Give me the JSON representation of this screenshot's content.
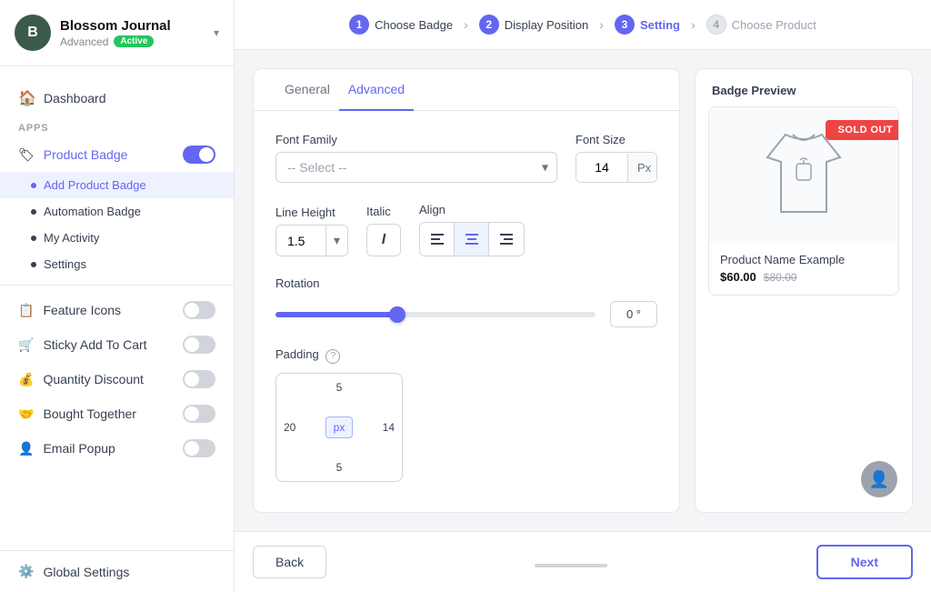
{
  "sidebar": {
    "avatar_letter": "B",
    "shop_name": "Blossom Journal",
    "shop_plan": "Advanced",
    "shop_status": "Active",
    "nav": {
      "dashboard_label": "Dashboard",
      "apps_section": "APPS",
      "apps": [
        {
          "label": "Product Badge",
          "icon": "🏷",
          "toggle": true,
          "active": true,
          "subnav": [
            {
              "label": "Add Product Badge",
              "active": true
            },
            {
              "label": "Automation Badge",
              "active": false
            },
            {
              "label": "My Activity",
              "active": false
            },
            {
              "label": "Settings",
              "active": false
            }
          ]
        },
        {
          "label": "Feature Icons",
          "icon": "📋",
          "toggle": false
        },
        {
          "label": "Sticky Add To Cart",
          "icon": "🛒",
          "toggle": false
        },
        {
          "label": "Quantity Discount",
          "icon": "💰",
          "toggle": false
        },
        {
          "label": "Bought Together",
          "icon": "🤝",
          "toggle": false
        },
        {
          "label": "Email Popup",
          "icon": "👤",
          "toggle": false
        }
      ]
    },
    "global_settings": "Global Settings"
  },
  "wizard": {
    "steps": [
      {
        "num": "1",
        "label": "Choose Badge",
        "state": "done"
      },
      {
        "num": "2",
        "label": "Display Position",
        "state": "done"
      },
      {
        "num": "3",
        "label": "Setting",
        "state": "current"
      },
      {
        "num": "4",
        "label": "Choose Product",
        "state": "inactive"
      }
    ]
  },
  "form": {
    "tabs": [
      {
        "label": "General",
        "active": false
      },
      {
        "label": "Advanced",
        "active": true
      }
    ],
    "font_family_label": "Font Family",
    "font_family_placeholder": "-- Select --",
    "font_size_label": "Font Size",
    "font_size_value": "14",
    "font_size_unit": "Px",
    "line_height_label": "Line Height",
    "line_height_value": "1.5",
    "italic_label": "Italic",
    "align_label": "Align",
    "rotation_label": "Rotation",
    "rotation_value": "0",
    "rotation_unit": "°",
    "padding_label": "Padding",
    "padding_help": "?",
    "padding_top": "5",
    "padding_bottom": "5",
    "padding_left": "20",
    "padding_right": "14",
    "padding_unit": "px"
  },
  "preview": {
    "title": "Badge Preview",
    "sold_out_label": "SOLD OUT",
    "product_name": "Product Name Example",
    "price_current": "$60.00",
    "price_original": "$80.00"
  },
  "bottom_bar": {
    "back_label": "Back",
    "next_label": "Next"
  }
}
